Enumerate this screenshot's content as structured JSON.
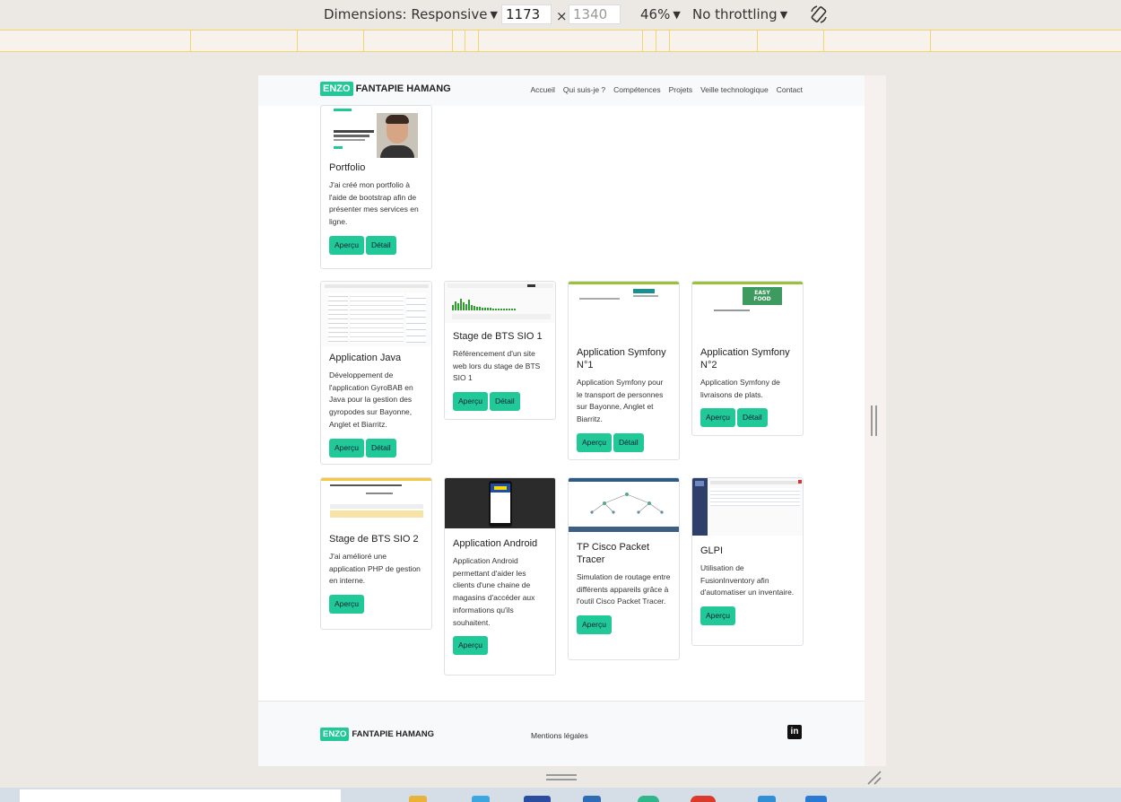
{
  "devtools": {
    "dimensions_label": "Dimensions: Responsive",
    "width_value": "1173",
    "height_placeholder": "1340",
    "times": "×",
    "zoom": "46%",
    "throttling": "No throttling"
  },
  "navbar": {
    "brand_badge": "ENZO",
    "brand_name": "FANTAPIE HAMANG",
    "links": [
      "Accueil",
      "Qui suis-je ?",
      "Compétences",
      "Projets",
      "Veille technologique",
      "Contact"
    ]
  },
  "cards": [
    {
      "title": "Portfolio",
      "desc": "J'ai créé mon portfolio à l'aide de bootstrap afin de présenter mes services en ligne.",
      "buttons": [
        "Aperçu",
        "Détail"
      ]
    },
    {
      "title": "Application Java",
      "desc": "Développement de l'application GyroBAB en Java pour la gestion des gyropodes sur Bayonne, Anglet et Biarritz.",
      "buttons": [
        "Aperçu",
        "Détail"
      ]
    },
    {
      "title": "Stage de BTS SIO 1",
      "desc": "Référencement d'un site web lors du stage de BTS SIO 1",
      "buttons": [
        "Aperçu",
        "Détail"
      ]
    },
    {
      "title": "Application Symfony N°1",
      "desc": "Application Symfony pour le transport de personnes sur Bayonne, Anglet et Biarritz.",
      "buttons": [
        "Aperçu",
        "Détail"
      ]
    },
    {
      "title": "Application Symfony N°2",
      "desc": "Application Symfony de livraisons de plats.",
      "buttons": [
        "Aperçu",
        "Détail"
      ]
    },
    {
      "title": "Stage de BTS SIO 2",
      "desc": "J'ai amélioré une application PHP de gestion en interne.",
      "buttons": [
        "Aperçu"
      ]
    },
    {
      "title": "Application Android",
      "desc": "Application Android permettant d'aider les clients d'une chaine de magasins d'accéder aux informations qu'ils souhaitent.",
      "buttons": [
        "Aperçu"
      ]
    },
    {
      "title": "TP Cisco Packet Tracer",
      "desc": "Simulation de routage entre différents appareils grâce à l'outil Cisco Packet Tracer.",
      "buttons": [
        "Aperçu"
      ]
    },
    {
      "title": "GLPI",
      "desc": "Utilisation de FusionInventory afin d'automatiser un inventaire.",
      "buttons": [
        "Aperçu"
      ]
    }
  ],
  "footer": {
    "brand_badge": "ENZO",
    "brand_name": "FANTAPIE HAMANG",
    "legal": "Mentions légales",
    "social_icon": "linkedin-icon",
    "social_text": "in"
  },
  "colors": {
    "accent": "#20c997",
    "ruler": "#f2d571",
    "navbar_bg": "#f8f9fa"
  }
}
